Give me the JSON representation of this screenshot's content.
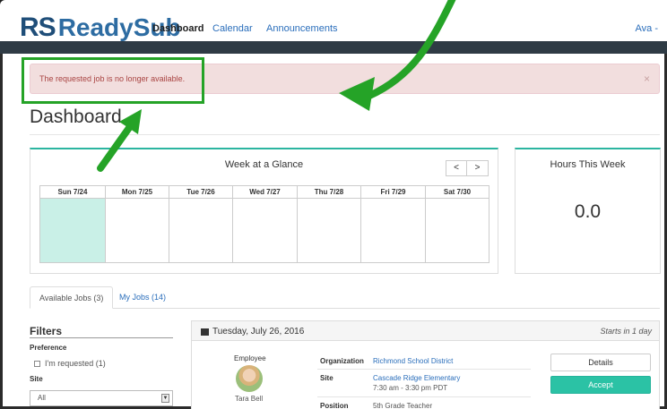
{
  "nav": {
    "logo_rs": "RS",
    "logo_text": "ReadySub",
    "links": [
      "Dashboard",
      "Calendar",
      "Announcements"
    ],
    "user": "Ava -"
  },
  "alert": {
    "message": "The requested job is no longer available.",
    "close": "×"
  },
  "page": {
    "title": "Dashboard"
  },
  "week": {
    "title": "Week at a Glance",
    "prev": "<",
    "next": ">",
    "days": [
      "Sun 7/24",
      "Mon 7/25",
      "Tue 7/26",
      "Wed 7/27",
      "Thu 7/28",
      "Fri 7/29",
      "Sat 7/30"
    ]
  },
  "hours": {
    "title": "Hours This Week",
    "value": "0.0"
  },
  "tabs": [
    "Available Jobs (3)",
    "My Jobs (14)"
  ],
  "filters": {
    "title": "Filters",
    "preference_label": "Preference",
    "requested_label": "I'm requested (1)",
    "site_label": "Site",
    "site_value": "All"
  },
  "job": {
    "date": "Tuesday, July 26, 2016",
    "starts": "Starts in 1 day",
    "employee_label": "Employee",
    "employee_name": "Tara Bell",
    "organization_label": "Organization",
    "organization_value": "Richmond School District",
    "site_label": "Site",
    "site_value": "Cascade Ridge Elementary",
    "site_time": "7:30 am - 3:30 pm PDT",
    "position_label": "Position",
    "position_value": "5th Grade Teacher",
    "details_button": "Details",
    "accept_button": "Accept"
  },
  "colors": {
    "accent": "#2bb5a0",
    "alert_bg": "#f2dede",
    "alert_text": "#a94442",
    "annotation_green": "#25a327"
  }
}
